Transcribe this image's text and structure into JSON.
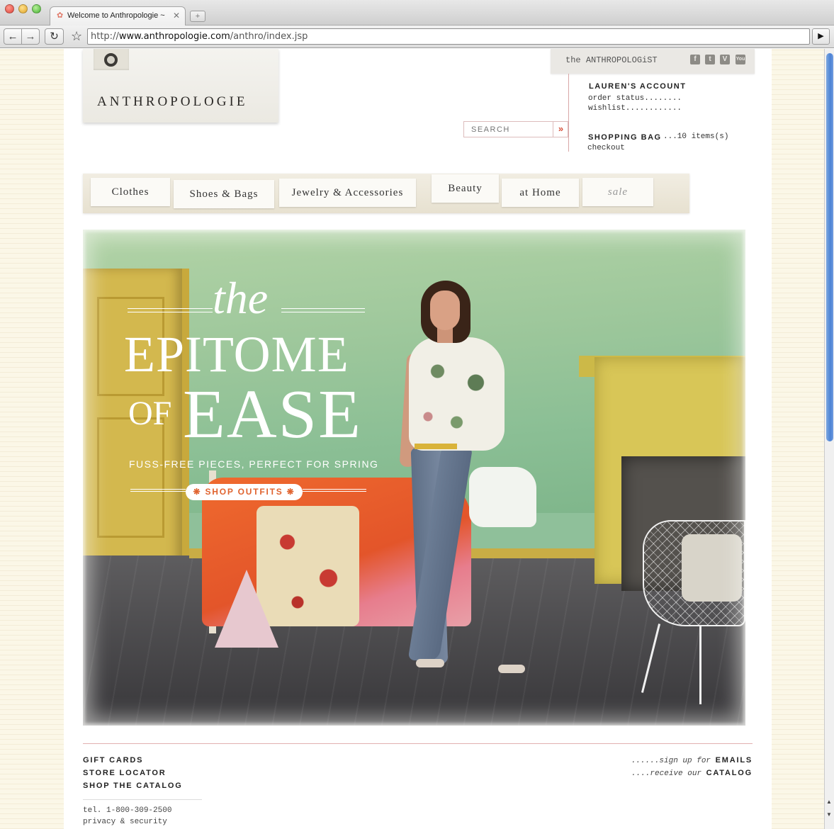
{
  "browser": {
    "tab_title": "Welcome to Anthropologie ~",
    "tab_favicon": "flower-icon",
    "url_prefix": "http://",
    "url_host": "www.anthropologie.com",
    "url_path": "/anthro/index.jsp",
    "buttons": {
      "back": "back-icon",
      "forward": "forward-icon",
      "reload": "reload-icon",
      "bookmark": "star-icon",
      "go": "play-icon"
    }
  },
  "header": {
    "logo": "ANTHROPOLOGIE",
    "anthropologist_prefix": "the",
    "anthropologist": "ANTHROPOLOGiST",
    "social": [
      {
        "icon": "facebook-icon",
        "glyph": "f"
      },
      {
        "icon": "twitter-icon",
        "glyph": "t"
      },
      {
        "icon": "vimeo-icon",
        "glyph": "V"
      },
      {
        "icon": "youtube-icon",
        "glyph": "You"
      }
    ],
    "account_title": "LAUREN'S ACCOUNT",
    "order_status": "order status........",
    "wishlist": "wishlist............",
    "bag_title": "SHOPPING BAG",
    "bag_count": "...10 items(s)",
    "checkout": "checkout",
    "search_placeholder": "SEARCH",
    "search_go": "»"
  },
  "nav": {
    "items": [
      "Clothes",
      "Shoes & Bags",
      "Jewelry & Accessories",
      "Beauty",
      "at Home",
      "sale"
    ]
  },
  "hero": {
    "the": "the",
    "epitome": "EPITOME",
    "of": "OF",
    "ease": "EASE",
    "subtitle": "FUSS-FREE PIECES, PERFECT FOR SPRING",
    "cta": "❋ SHOP OUTFITS ❋"
  },
  "footer": {
    "links": [
      "GIFT CARDS",
      "STORE LOCATOR",
      "SHOP THE CATALOG"
    ],
    "tel": "tel. 1-800-309-2500",
    "privacy": "privacy & security",
    "emails_prefix": "......sign up for ",
    "emails": "EMAILS",
    "catalog_prefix": "....receive our ",
    "catalog": "CATALOG"
  },
  "colors": {
    "accent_orange": "#e0632f",
    "page_background": "#fbf7e7",
    "divider_pink": "#e2b0b0"
  }
}
